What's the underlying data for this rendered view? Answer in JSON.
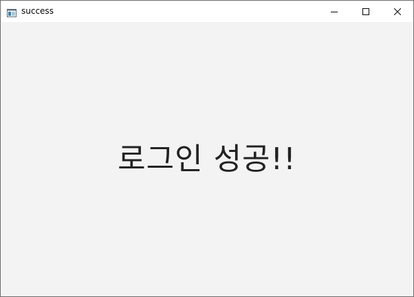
{
  "window": {
    "title": "success",
    "app_icon": "window-app-icon",
    "controls": {
      "minimize_icon": "minimize-icon",
      "maximize_icon": "maximize-icon",
      "close_icon": "close-icon"
    }
  },
  "content": {
    "message": "로그인 성공!!"
  },
  "colors": {
    "client_background": "#f3f3f3",
    "titlebar_background": "#ffffff",
    "message_text": "#222222"
  }
}
